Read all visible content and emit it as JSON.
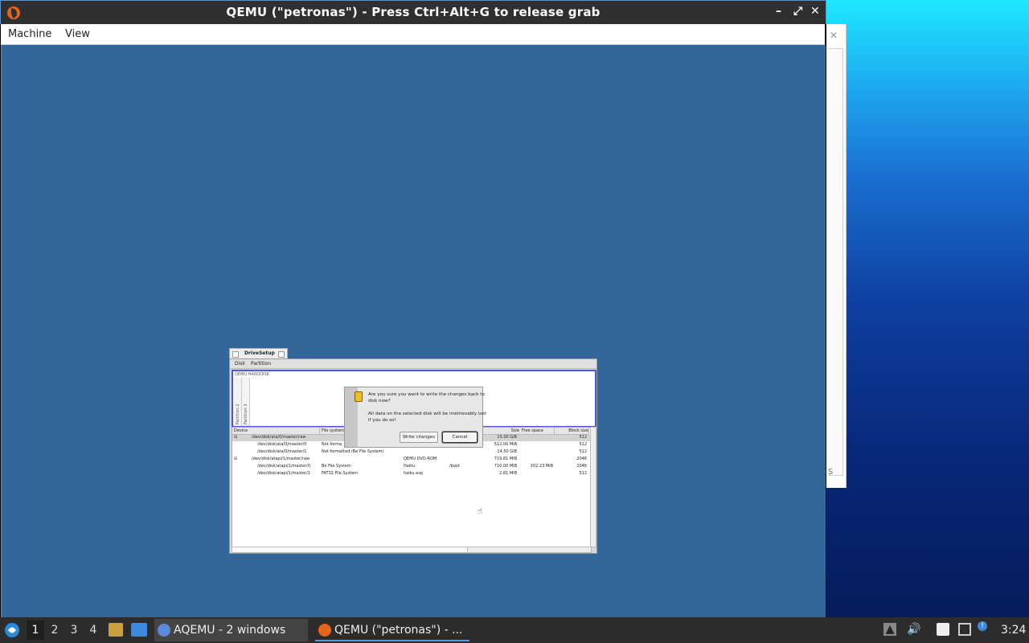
{
  "qemu": {
    "title": "QEMU (\"petronas\") - Press Ctrl+Alt+G to release grab",
    "menu": [
      "Machine",
      "View"
    ],
    "controls": {
      "minimize": "–",
      "maximize": "⤢",
      "close": "✕"
    }
  },
  "background_window": {
    "partial_text": "s"
  },
  "drivesetup": {
    "title": "DriveSetup",
    "menu": [
      "Disk",
      "Partition"
    ],
    "disk_label": "QEMU HARDDISK",
    "partitions": [
      "Partition 2",
      "Partition 3"
    ],
    "columns": [
      "Device",
      "File system",
      "Size",
      "Free space",
      "Block size"
    ],
    "rows": [
      {
        "exp": "⊟",
        "device": "/dev/disk/ata/0/master/raw",
        "fs": "",
        "name": "",
        "mount": "",
        "size": "15.00 GiB",
        "free": "",
        "block": "512"
      },
      {
        "exp": "",
        "device": "/dev/disk/ata/0/master/0",
        "fs": "Not forma",
        "name": "",
        "mount": "",
        "size": "512.00 MiB",
        "free": "",
        "block": "512"
      },
      {
        "exp": "",
        "device": "/dev/disk/ata/0/master/1",
        "fs": "Not formatted (Be File System)",
        "name": "",
        "mount": "",
        "size": "14.50 GiB",
        "free": "",
        "block": "512"
      },
      {
        "exp": "⊟",
        "device": "/dev/disk/atapi/1/master/raw",
        "fs": "",
        "name": "QEMU DVD-ROM",
        "mount": "",
        "size": "719.81 MiB",
        "free": "",
        "block": "2048"
      },
      {
        "exp": "",
        "device": "/dev/disk/atapi/1/master/0",
        "fs": "Be File System",
        "name": "Haiku",
        "mount": "/boot",
        "size": "710.00 MiB",
        "free": "102.23 MiB",
        "block": "2048"
      },
      {
        "exp": "",
        "device": "/dev/disk/atapi/1/master/1",
        "fs": "FAT32 File System",
        "name": "haiku esp",
        "mount": "",
        "size": "2.81 MiB",
        "free": "",
        "block": "512"
      }
    ]
  },
  "alert": {
    "line1": "Are you sure you want to write the changes back to",
    "line2": "disk now?",
    "line3": "All data on the selected disk will be irretrievably lost",
    "line4": "if you do so!",
    "write_label": "Write changes",
    "cancel_label": "Cancel"
  },
  "taskbar": {
    "workspaces": [
      "1",
      "2",
      "3",
      "4"
    ],
    "tasks": [
      "AQEMU - 2 windows",
      "QEMU (\"petronas\") - ..."
    ],
    "clock": "3:24"
  }
}
